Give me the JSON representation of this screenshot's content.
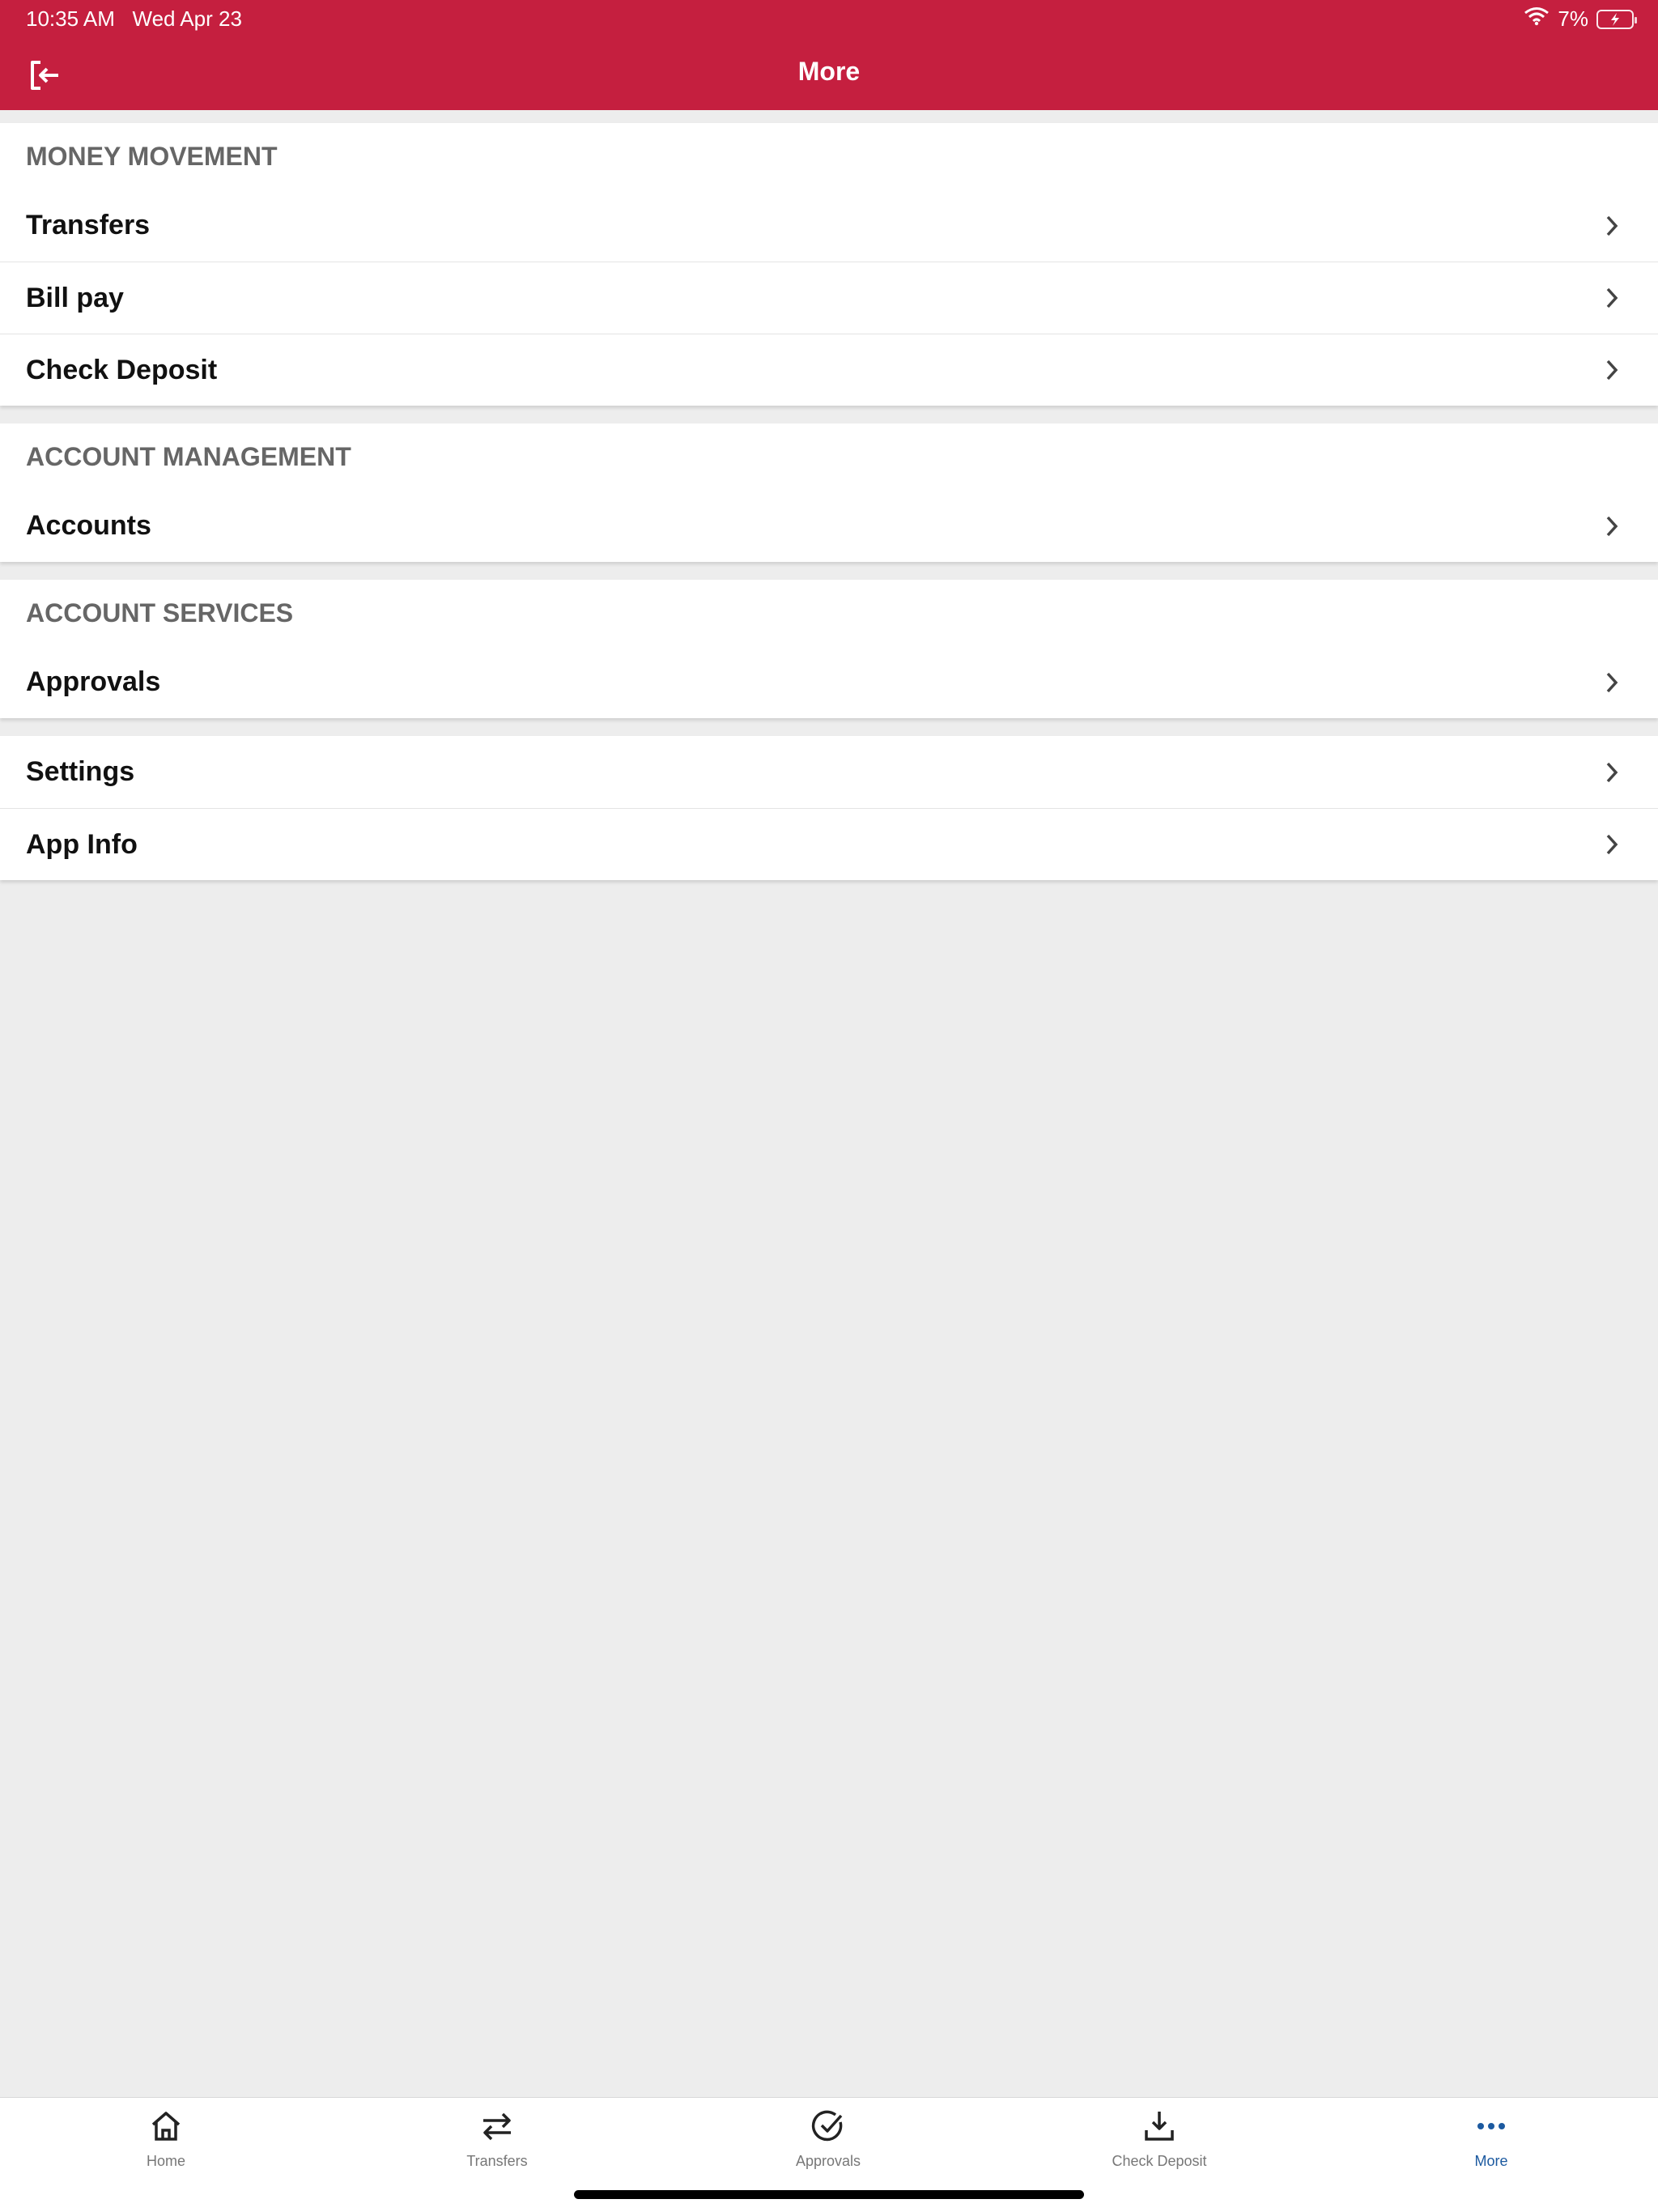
{
  "status_bar": {
    "time": "10:35 AM   Wed Apr 23",
    "battery": "7%"
  },
  "header": {
    "title": "More",
    "background_color": "#c51f3f"
  },
  "sections": [
    {
      "header": "MONEY MOVEMENT",
      "items": [
        "Transfers",
        "Bill pay",
        "Check Deposit"
      ]
    },
    {
      "header": "ACCOUNT MANAGEMENT",
      "items": [
        "Accounts"
      ]
    },
    {
      "header": "ACCOUNT SERVICES",
      "items": [
        "Approvals"
      ]
    },
    {
      "header": "",
      "items": [
        "Settings",
        "App Info"
      ]
    }
  ],
  "tabbar": {
    "active_color": "#1c5aa0",
    "tabs": [
      {
        "label": "Home",
        "icon": "home-icon"
      },
      {
        "label": "Transfers",
        "icon": "transfer-arrows-icon"
      },
      {
        "label": "Approvals",
        "icon": "check-circle-icon"
      },
      {
        "label": "Check Deposit",
        "icon": "download-tray-icon"
      },
      {
        "label": "More",
        "icon": "more-dots-icon",
        "active": true
      }
    ]
  }
}
